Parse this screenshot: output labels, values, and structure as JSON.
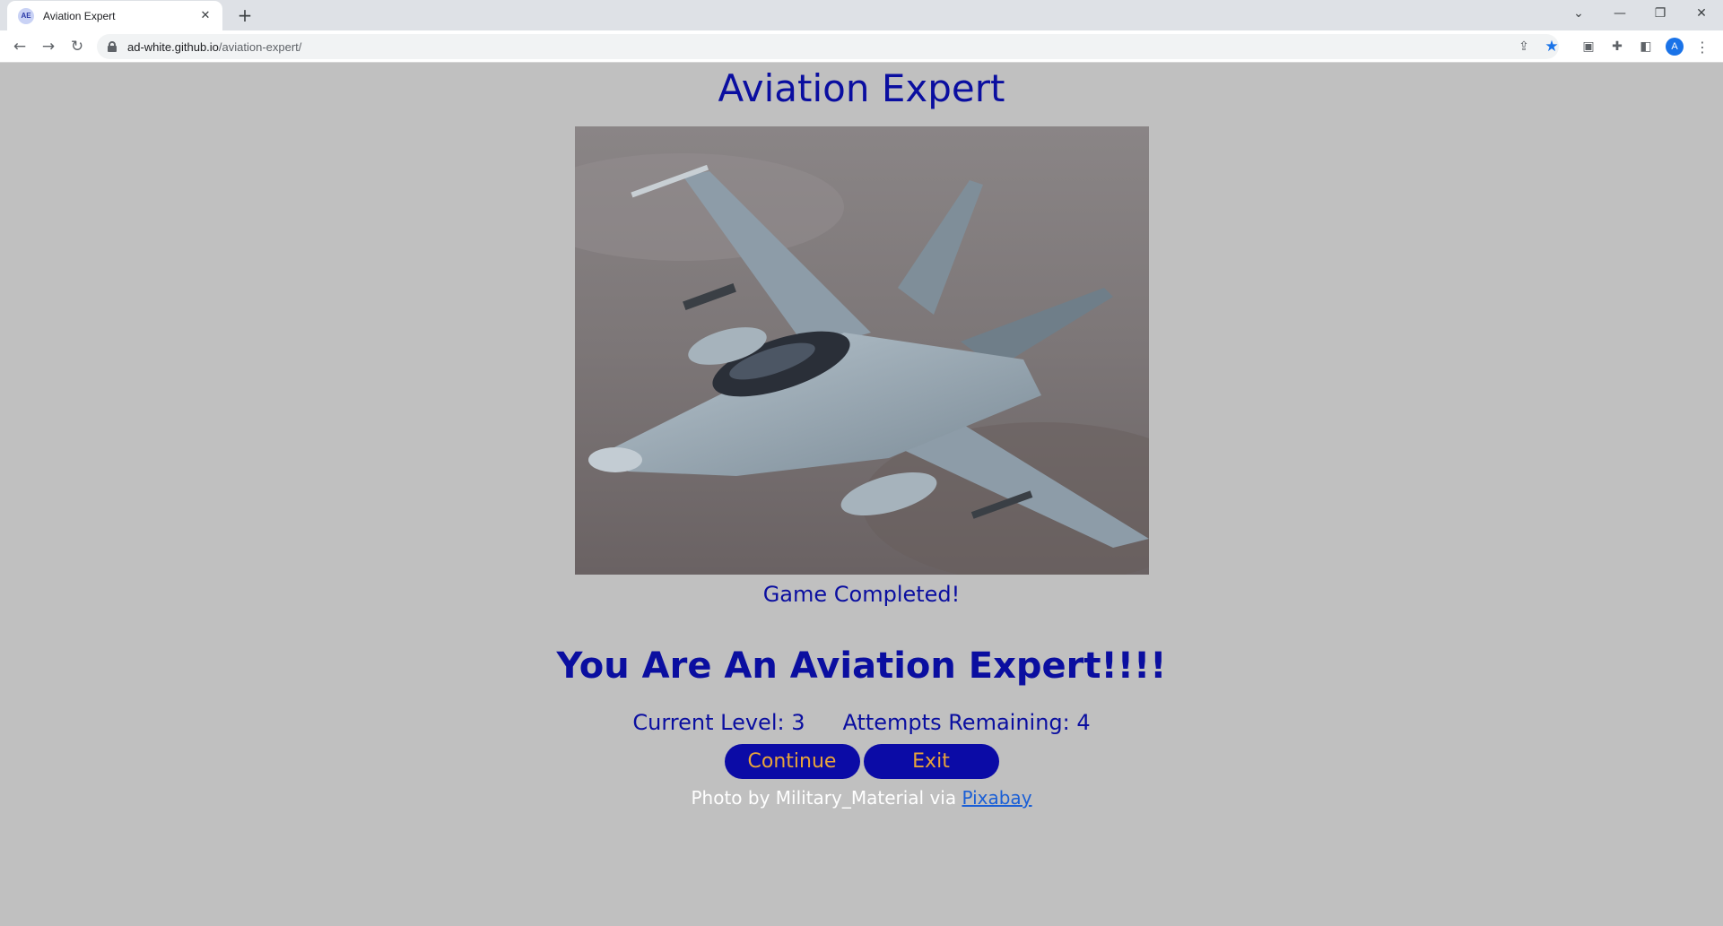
{
  "browser": {
    "tab": {
      "favicon_text": "AE",
      "title": "Aviation Expert"
    },
    "url": {
      "host": "ad-white.github.io",
      "path": "/aviation-expert/"
    },
    "profile_initial": "A"
  },
  "page": {
    "title": "Aviation Expert",
    "status": "Game Completed!",
    "headline": "You Are An Aviation Expert!!!!",
    "current_level_label": "Current Level: 3",
    "attempts_label": "Attempts Remaining: 4",
    "continue_label": "Continue",
    "exit_label": "Exit",
    "credit_prefix": "Photo by Military_Material via ",
    "credit_link": "Pixabay"
  },
  "colors": {
    "page_bg": "#c0c0c0",
    "text": "#0a0ea0",
    "button_bg": "#0b0ba6",
    "button_text": "#e8a43a",
    "link": "#1a5fd6"
  }
}
